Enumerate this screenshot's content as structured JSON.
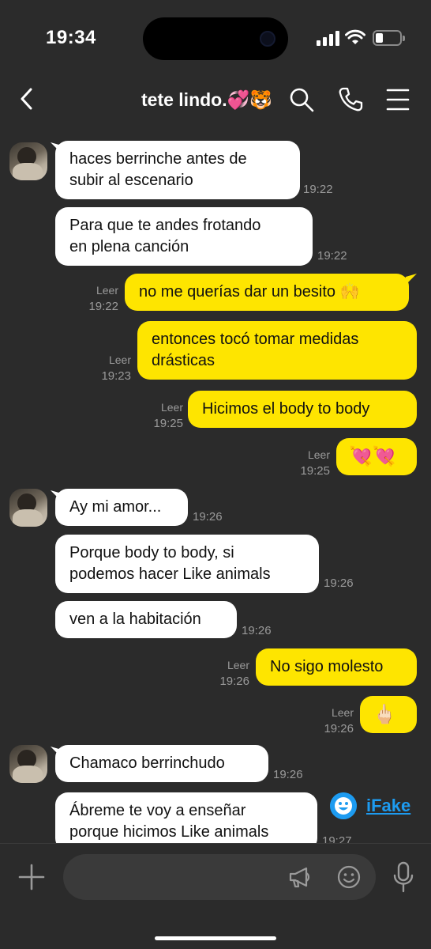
{
  "status_bar": {
    "time": "19:34"
  },
  "header": {
    "title": "tete lindo.💞🐯"
  },
  "messages": [
    {
      "text1": "haces berrinche antes de",
      "text2": "subir al escenario",
      "time": "19:22"
    },
    {
      "text1": "Para que te andes frotando",
      "text2": "en plena canción",
      "time": "19:22"
    },
    {
      "text1": "no me querías dar un besito 🙌",
      "read": "Leer",
      "time": "19:22"
    },
    {
      "text1": "entonces tocó tomar medidas",
      "text2": "drásticas",
      "read": "Leer",
      "time": "19:23"
    },
    {
      "text1": "Hicimos el body to body",
      "read": "Leer",
      "time": "19:25"
    },
    {
      "text1": "💘💘",
      "read": "Leer",
      "time": "19:25"
    },
    {
      "text1": "Ay mi amor...",
      "time": "19:26"
    },
    {
      "text1": "Porque body to body, si",
      "text2": "podemos hacer Like animals",
      "time": "19:26"
    },
    {
      "text1": "ven a la habitación",
      "time": "19:26"
    },
    {
      "text1": "No sigo molesto",
      "read": "Leer",
      "time": "19:26"
    },
    {
      "text1": "🖕🏻",
      "read": "Leer",
      "time": "19:26"
    },
    {
      "text1": "Chamaco berrinchudo",
      "time": "19:26"
    },
    {
      "text1": "Ábreme te voy a enseñar",
      "text2": "porque hicimos Like animals",
      "time": "19:27"
    }
  ],
  "watermark": {
    "label": "iFake"
  },
  "input": {
    "placeholder": ""
  },
  "icons": {
    "back": "chevron-left-icon",
    "search": "search-icon",
    "call": "phone-icon",
    "menu": "menu-icon",
    "plus": "plus-icon",
    "megaphone": "megaphone-icon",
    "emoji": "emoji-icon",
    "mic": "microphone-icon"
  },
  "colors": {
    "background": "#2b2b2b",
    "incoming": "#ffffff",
    "outgoing": "#fee500",
    "meta": "#9a9a9a"
  }
}
